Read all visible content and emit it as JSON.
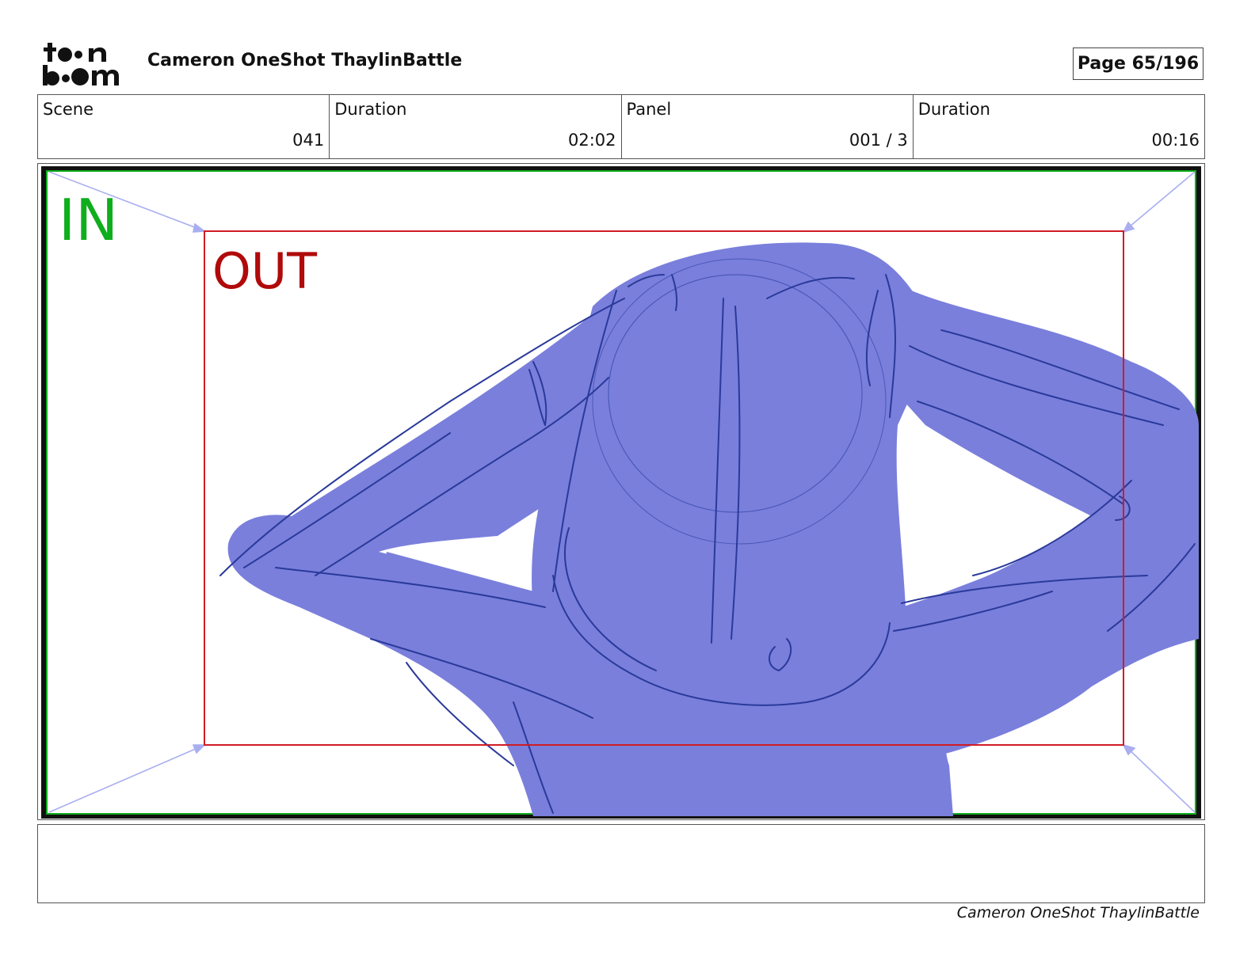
{
  "header": {
    "logo_text": "toon boom",
    "title": "Cameron OneShot ThaylinBattle",
    "page_label": "Page",
    "page_number": "65/196"
  },
  "info": {
    "scene_label": "Scene",
    "scene_value": "041",
    "scene_duration_label": "Duration",
    "scene_duration_value": "02:02",
    "panel_label": "Panel",
    "panel_value": "001 / 3",
    "panel_duration_label": "Duration",
    "panel_duration_value": "00:16"
  },
  "panel": {
    "in_label": "IN",
    "out_label": "OUT",
    "colors": {
      "in": "#0fae1c",
      "out": "#b00a0a",
      "figure_fill": "#7a7fdc",
      "sketch_line": "#2a3a9a",
      "arrow": "#a9aef0"
    }
  },
  "notes": {
    "text": ""
  },
  "footer": {
    "text": "Cameron OneShot ThaylinBattle"
  }
}
